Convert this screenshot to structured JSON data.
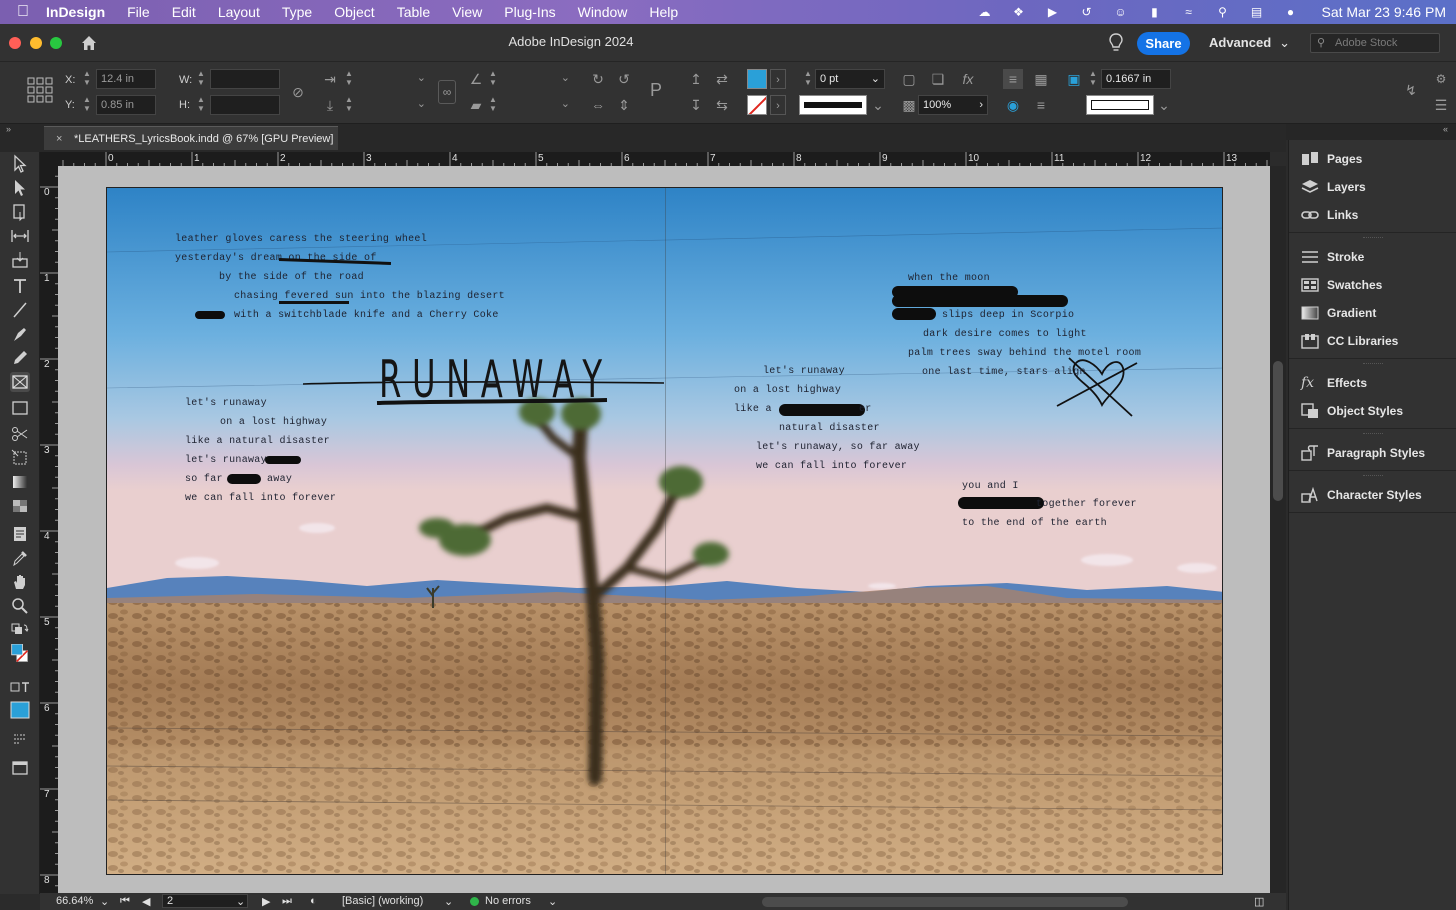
{
  "menubar": {
    "app_name": "InDesign",
    "items": [
      "File",
      "Edit",
      "Layout",
      "Type",
      "Object",
      "Table",
      "View",
      "Plug-Ins",
      "Window",
      "Help"
    ],
    "clock": "Sat Mar 23  9:46 PM"
  },
  "titlebar": {
    "title": "Adobe InDesign 2024",
    "share_label": "Share",
    "workspace": "Advanced",
    "stock_placeholder": "Adobe Stock"
  },
  "control": {
    "x_label": "X:",
    "x_value": "12.4 in",
    "y_label": "Y:",
    "y_value": "0.85 in",
    "w_label": "W:",
    "h_label": "H:",
    "stroke_weight": "0 pt",
    "opacity": "100%",
    "gap_value": "0.1667 in",
    "fill_color": "#2aa0d8"
  },
  "document": {
    "tab_label": "*LEATHERS_LyricsBook.indd @ 67% [GPU Preview]",
    "close_glyph": "×"
  },
  "ruler": {
    "h_labels": [
      "0",
      "1",
      "2",
      "3",
      "4",
      "5",
      "6",
      "7",
      "8",
      "9",
      "10",
      "11",
      "12",
      "13"
    ],
    "v_labels": [
      "0",
      "1",
      "2",
      "3",
      "4",
      "5",
      "6",
      "7",
      "8"
    ]
  },
  "spread": {
    "title_word": "RUNAWAY",
    "left_top": [
      "leather gloves caress the steering wheel",
      "yesterday's dream on the side of",
      "by the side of the road",
      "chasing fevered sun into the blazing desert",
      "with a switchblade knife and a Cherry Coke"
    ],
    "left_mid": [
      "let's runaway",
      "on a lost highway",
      "like a natural disaster",
      "let's runaway",
      "so far",
      "away",
      "we can fall into forever"
    ],
    "right_mid": [
      "let's runaway",
      "on a lost highway",
      "like a",
      "er",
      "natural disaster",
      "let's runaway, so far away",
      "we can fall into forever"
    ],
    "right_top": [
      "when the moon",
      "slips deep in Scorpio",
      "dark desire comes to light",
      "palm trees sway behind the motel room",
      "one last time, stars align"
    ],
    "right_bottom": [
      "you and I",
      "together forever",
      "to the end of the earth"
    ]
  },
  "status": {
    "zoom": "66.64%",
    "page": "2",
    "preflight_profile": "[Basic] (working)",
    "errors": "No errors"
  },
  "panels": [
    {
      "label": "Pages",
      "icon": "pages-icon"
    },
    {
      "label": "Layers",
      "icon": "layers-icon"
    },
    {
      "label": "Links",
      "icon": "links-icon"
    },
    {
      "label": "Stroke",
      "icon": "stroke-icon"
    },
    {
      "label": "Swatches",
      "icon": "swatches-icon"
    },
    {
      "label": "Gradient",
      "icon": "gradient-icon"
    },
    {
      "label": "CC Libraries",
      "icon": "cc-libraries-icon"
    },
    {
      "label": "Effects",
      "icon": "effects-icon"
    },
    {
      "label": "Object Styles",
      "icon": "object-styles-icon"
    },
    {
      "label": "Paragraph Styles",
      "icon": "paragraph-styles-icon"
    },
    {
      "label": "Character Styles",
      "icon": "character-styles-icon"
    }
  ]
}
